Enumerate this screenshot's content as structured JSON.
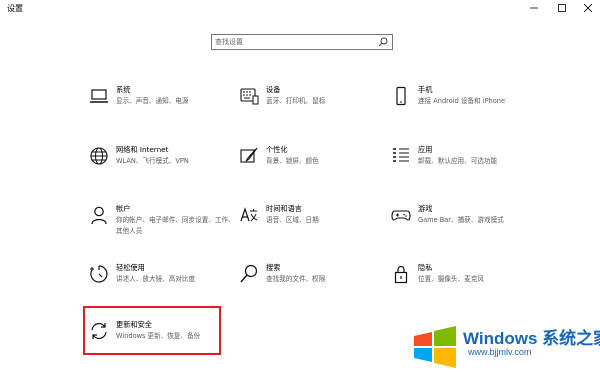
{
  "window": {
    "title": "设置"
  },
  "search": {
    "placeholder": "查找设置"
  },
  "categories": [
    {
      "label": "系统",
      "desc": "显示、声音、通知、电源",
      "icon": "laptop-icon"
    },
    {
      "label": "设备",
      "desc": "蓝牙、打印机、鼠标",
      "icon": "keyboard-printer-icon"
    },
    {
      "label": "手机",
      "desc": "连接 Android 设备和 iPhone",
      "icon": "phone-icon"
    },
    {
      "label": "网络和 Internet",
      "desc": "WLAN、飞行模式、VPN",
      "icon": "globe-icon"
    },
    {
      "label": "个性化",
      "desc": "背景、锁屏、颜色",
      "icon": "brush-icon"
    },
    {
      "label": "应用",
      "desc": "卸载、默认应用、可选功能",
      "icon": "apps-list-icon"
    },
    {
      "label": "帐户",
      "desc": "你的帐户、电子邮件、同步设置、工作、其他人员",
      "icon": "person-icon"
    },
    {
      "label": "时间和语言",
      "desc": "语音、区域、日期",
      "icon": "time-language-icon"
    },
    {
      "label": "游戏",
      "desc": "Game Bar、捕获、游戏模式",
      "icon": "gamepad-icon"
    },
    {
      "label": "轻松使用",
      "desc": "讲述人、放大镜、高对比度",
      "icon": "ease-of-access-icon"
    },
    {
      "label": "搜索",
      "desc": "查找我的文件、权限",
      "icon": "search-icon"
    },
    {
      "label": "隐私",
      "desc": "位置、摄像头、麦克风",
      "icon": "lock-icon"
    },
    {
      "label": "更新和安全",
      "desc": "Windows 更新、恢复、备份",
      "icon": "sync-icon"
    }
  ],
  "watermark": {
    "brand": "Windows 系统之家",
    "url": "www.bjjmlv.com"
  },
  "colors": {
    "highlight": "#e02020",
    "watermark": "#1a66b3"
  }
}
